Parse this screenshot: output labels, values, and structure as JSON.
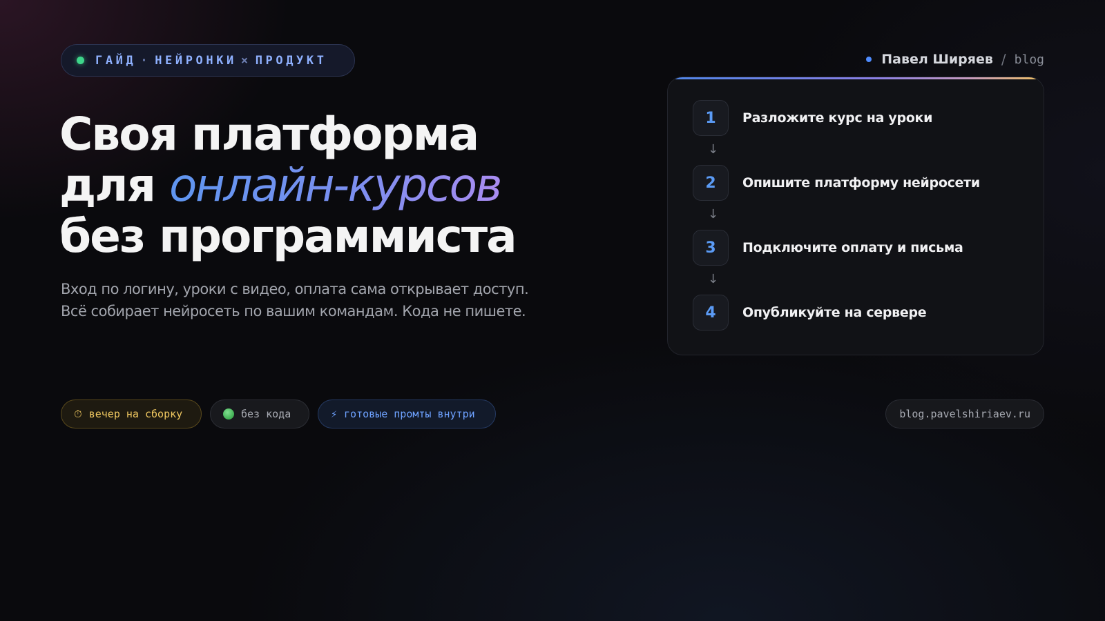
{
  "badge": {
    "part1": "ГАЙД",
    "sep1": "·",
    "part2": "НЕЙРОНКИ",
    "sep2": "×",
    "part3": "ПРОДУКТ",
    "dot_color": "#3ed58a"
  },
  "author": {
    "name": "Павел Ширяев",
    "slash": "/",
    "section": "blog"
  },
  "headline": {
    "line1": "Своя платформа",
    "line2_prefix": "для ",
    "line2_accent": "онлайн-курсов",
    "line3": "без программиста"
  },
  "subtitle": {
    "line1": "Вход по логину, уроки с видео, оплата сама открывает доступ.",
    "line2": "Всё собирает нейросеть по вашим командам. Кода не пишете."
  },
  "steps": [
    {
      "num": "1",
      "label": "Разложите курс на уроки"
    },
    {
      "num": "2",
      "label": "Опишите платформу нейросети"
    },
    {
      "num": "3",
      "label": "Подключите оплату и письма"
    },
    {
      "num": "4",
      "label": "Опубликуйте на сервере"
    }
  ],
  "arrow_glyph": "↓",
  "pills": {
    "evening": {
      "icon": "⏱",
      "label": "вечер на сборку"
    },
    "nocode": {
      "icon": "green-circle-icon",
      "label": "без кода"
    },
    "prompts": {
      "icon": "⚡",
      "label": "готовые промты внутри"
    }
  },
  "site": "blog.pavelshiriaev.ru",
  "colors": {
    "background": "#0a0a0d",
    "accent_blue": "#5b9bf5",
    "accent_purple": "#a98cf0",
    "accent_yellow": "#f0c860"
  }
}
